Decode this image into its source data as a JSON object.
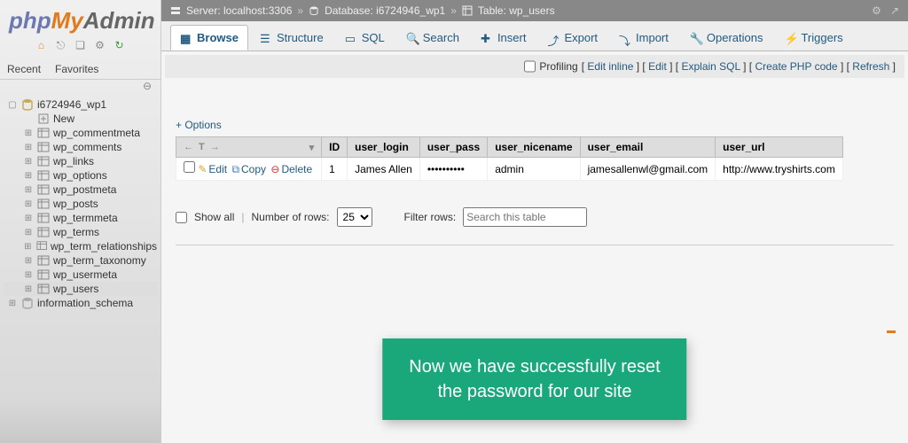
{
  "logo": {
    "php": "php",
    "my": "My",
    "admin": "Admin"
  },
  "sidebar_tabs": {
    "recent": "Recent",
    "favorites": "Favorites"
  },
  "tree": {
    "db": "i6724946_wp1",
    "tables": [
      "New",
      "wp_commentmeta",
      "wp_comments",
      "wp_links",
      "wp_options",
      "wp_postmeta",
      "wp_posts",
      "wp_termmeta",
      "wp_terms",
      "wp_term_relationships",
      "wp_term_taxonomy",
      "wp_usermeta",
      "wp_users"
    ],
    "selected": "wp_users",
    "other": "information_schema"
  },
  "breadcrumb": {
    "server": "Server: localhost:3306",
    "database": "Database: i6724946_wp1",
    "table": "Table: wp_users"
  },
  "tabs": [
    "Browse",
    "Structure",
    "SQL",
    "Search",
    "Insert",
    "Export",
    "Import",
    "Operations",
    "Triggers"
  ],
  "active_tab": "Browse",
  "profiling": {
    "label": "Profiling",
    "links": [
      "Edit inline",
      "Edit",
      "Explain SQL",
      "Create PHP code",
      "Refresh"
    ]
  },
  "options": "+ Options",
  "columns": [
    "ID",
    "user_login",
    "user_pass",
    "user_nicename",
    "user_email",
    "user_url"
  ],
  "row": {
    "edit": "Edit",
    "copy": "Copy",
    "delete": "Delete",
    "id": "1",
    "login": "James Allen",
    "pass": "••••••••••",
    "nice": "admin",
    "email": "jamesallenwl@gmail.com",
    "url": "http://www.tryshirts.com"
  },
  "pager": {
    "showall": "Show all",
    "numrows": "Number of rows:",
    "rows_value": "25",
    "filter": "Filter rows:",
    "filter_placeholder": "Search this table"
  },
  "overlay": {
    "line1": "Now we have successfully reset",
    "line2": "the password for our site"
  }
}
